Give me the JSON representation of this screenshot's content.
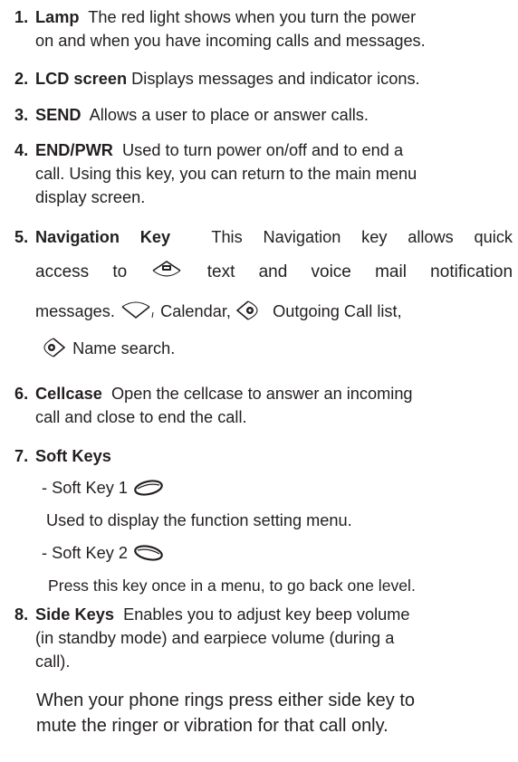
{
  "items": [
    {
      "num": "1.",
      "term": "Lamp",
      "lines": [
        "The red light shows when you turn the power",
        "on and when you have incoming calls and messages."
      ]
    },
    {
      "num": "2.",
      "term": "LCD  screen",
      "lines": [
        "Displays messages and indicator icons."
      ]
    },
    {
      "num": "3.",
      "term": "SEND",
      "lines": [
        "Allows a user to place or answer calls."
      ]
    },
    {
      "num": "4.",
      "term": "END/PWR",
      "lines": [
        "Used to turn power on/off and to end a",
        "call. Using this key, you can return to the main menu",
        "display screen."
      ]
    },
    {
      "num": "5.",
      "term": "Navigation Key",
      "lines": [
        "This Navigation key allows quick",
        "access to",
        "text and voice mail notification",
        "messages.",
        "Calendar,",
        "Outgoing Call list,",
        "Name search."
      ]
    },
    {
      "num": "6.",
      "term": "Cellcase",
      "lines": [
        "Open the cellcase to answer an incoming",
        "call and close to end the call."
      ]
    },
    {
      "num": "7.",
      "term": "Soft Keys"
    },
    {
      "num": "8.",
      "term": "Side Keys",
      "lines": [
        "Enables you to adjust key beep volume",
        "(in standby mode) and earpiece volume (during a",
        "call)."
      ]
    }
  ],
  "soft_keys": [
    {
      "label": "- Soft Key 1",
      "desc": "Used to display the function setting menu."
    },
    {
      "label": "- Soft Key 2",
      "desc": "Press this key once in a menu, to go back one level."
    }
  ],
  "side_note": [
    "When your phone rings press either side key to",
    "mute the ringer or vibration for that call only."
  ],
  "icons": [
    "nav-up-mail-icon",
    "nav-down-calendar-icon",
    "nav-left-outgoing-icon",
    "nav-right-name-search-icon",
    "soft-key-1-icon",
    "soft-key-2-icon"
  ]
}
